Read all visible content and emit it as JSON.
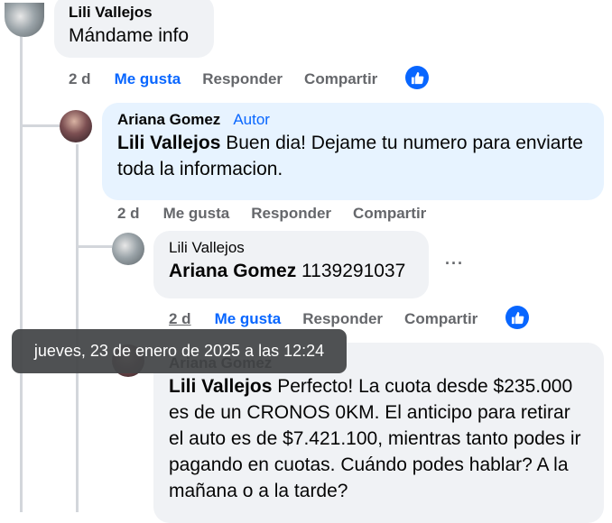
{
  "comments": [
    {
      "author": "Lili Vallejos",
      "text": "Mándame info",
      "time": "2 d",
      "like_label": "Me gusta",
      "reply_label": "Responder",
      "share_label": "Compartir"
    },
    {
      "author": "Ariana Gomez",
      "author_tag": "Autor",
      "mention": "Lili Vallejos",
      "text": " Buen dia! Dejame tu numero para enviarte toda la informacion.",
      "time": "2 d",
      "like_label": "Me gusta",
      "reply_label": "Responder",
      "share_label": "Compartir"
    },
    {
      "author": "Lili Vallejos",
      "mention": "Ariana Gomez",
      "text": " 1139291037",
      "more": "···",
      "time": "2 d",
      "like_label": "Me gusta",
      "reply_label": "Responder",
      "share_label": "Compartir"
    },
    {
      "author": "Ariana Gomez",
      "mention": "Lili Vallejos",
      "text": " Perfecto! La cuota desde $235.000 es de un CRONOS 0KM. El anticipo para retirar el auto es de $7.421.100, mientras tanto podes ir pagando en cuotas. Cuándo podes hablar? A la mañana o a la tarde?"
    }
  ],
  "tooltip": "jueves, 23 de enero de 2025 a las 12:24",
  "icons": {
    "like_badge": "thumbs-up-icon",
    "colors": {
      "accent": "#0866ff",
      "bubble": "#f0f2f5",
      "bubble_highlight": "#e7f3ff",
      "muted": "#65676b"
    }
  }
}
